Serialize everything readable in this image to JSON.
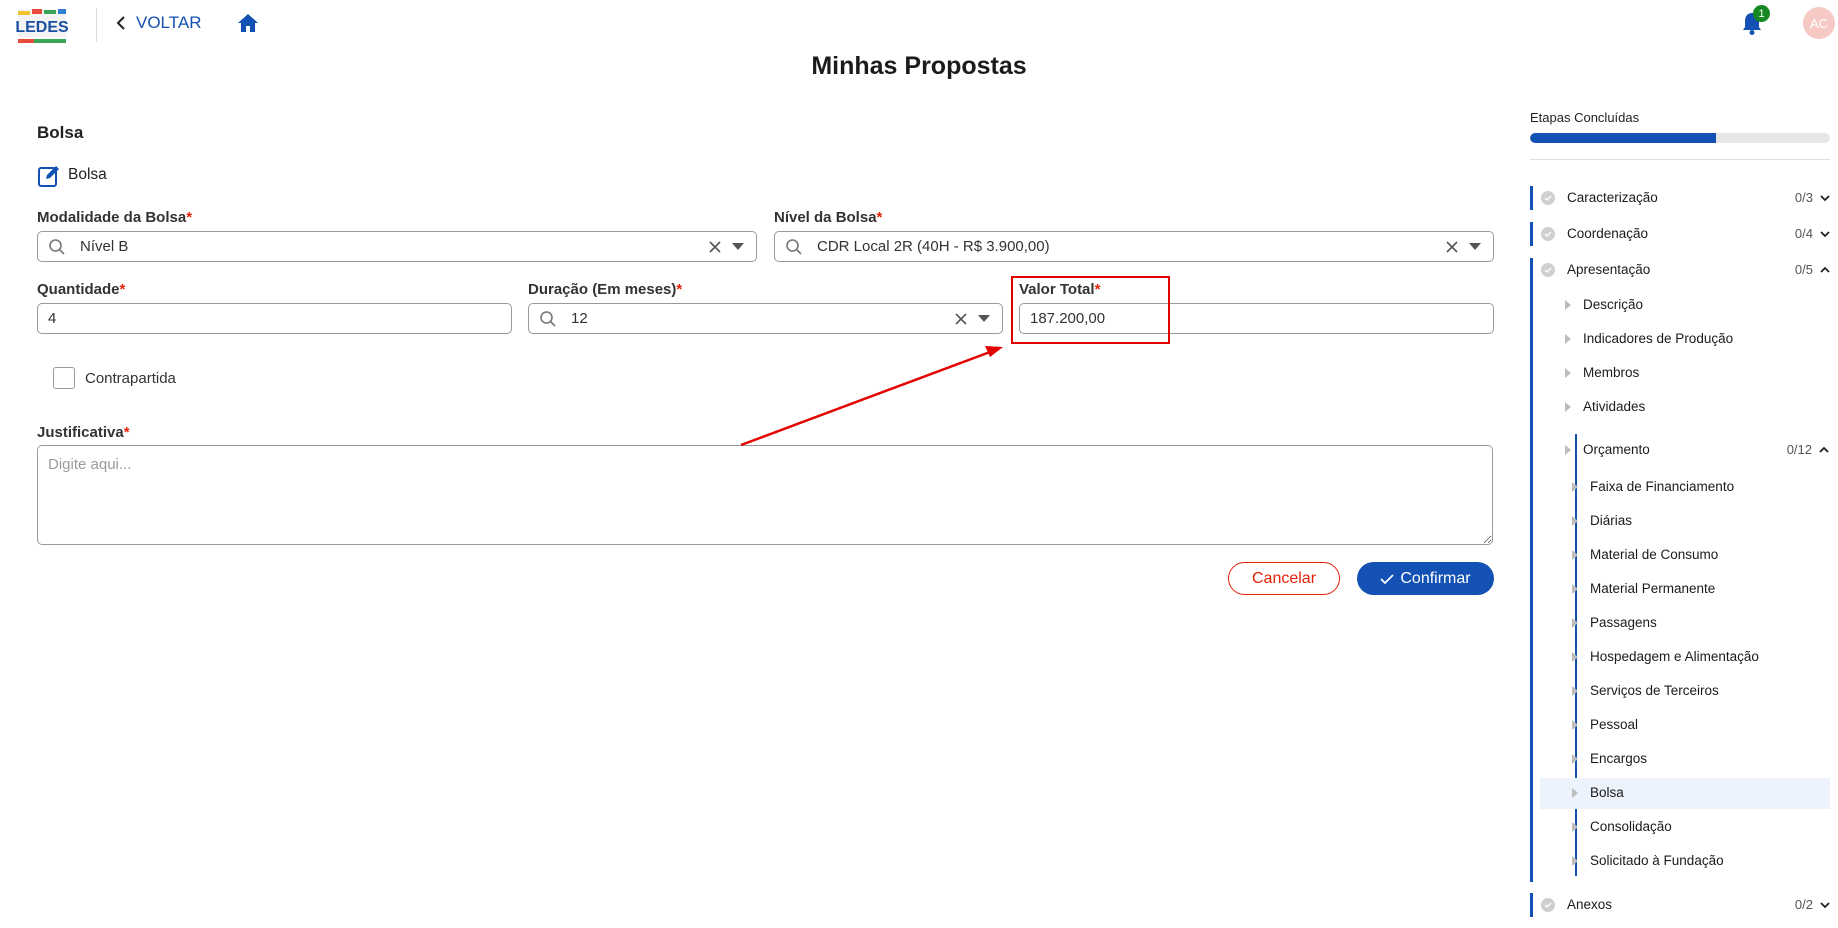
{
  "header": {
    "logo_text": "LEDES",
    "back_label": "VOLTAR",
    "notification_count": "1",
    "avatar_initials": "AC",
    "page_title": "Minhas Propostas"
  },
  "form": {
    "section_title": "Bolsa",
    "subsection_title": "Bolsa",
    "modalidade": {
      "label": "Modalidade da Bolsa",
      "value": "Nível B"
    },
    "nivel": {
      "label": "Nível da Bolsa",
      "value": "CDR Local 2R (40H - R$ 3.900,00)"
    },
    "quantidade": {
      "label": "Quantidade",
      "value": "4"
    },
    "duracao": {
      "label": "Duração (Em meses)",
      "value": "12"
    },
    "valor_total": {
      "label": "Valor Total",
      "value": "187.200,00"
    },
    "contrapartida_label": "Contrapartida",
    "justificativa": {
      "label": "Justificativa",
      "placeholder": "Digite aqui..."
    },
    "required_mark": "*",
    "cancel_label": "Cancelar",
    "confirm_label": "Confirmar"
  },
  "sidebar": {
    "title": "Etapas Concluídas",
    "progress_fraction": 0.62,
    "sections": [
      {
        "label": "Caracterização",
        "count": "0/3"
      },
      {
        "label": "Coordenação",
        "count": "0/4"
      },
      {
        "label": "Apresentação",
        "count": "0/5"
      }
    ],
    "apresentacao_items": [
      "Descrição",
      "Indicadores de Produção",
      "Membros",
      "Atividades"
    ],
    "orcamento": {
      "label": "Orçamento",
      "count": "0/12"
    },
    "orcamento_items": [
      "Faixa de Financiamento",
      "Diárias",
      "Material de Consumo",
      "Material Permanente",
      "Passagens",
      "Hospedagem e Alimentação",
      "Serviços de Terceiros",
      "Pessoal",
      "Encargos",
      "Bolsa",
      "Consolidação",
      "Solicitado à Fundação"
    ],
    "anexos": {
      "label": "Anexos",
      "count": "0/2"
    }
  },
  "colors": {
    "primary": "#1351b4",
    "danger": "#e52207",
    "annotation": "#e50000"
  }
}
